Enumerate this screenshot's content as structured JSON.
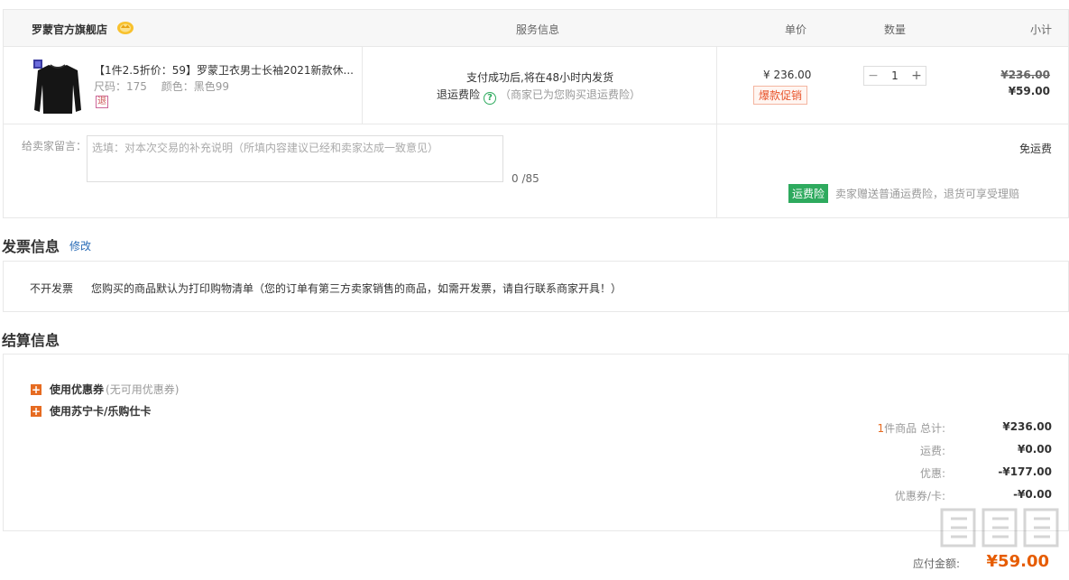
{
  "store": {
    "name": "罗蒙官方旗舰店",
    "badge_icon": "gold-crown-icon"
  },
  "columns": {
    "service": "服务信息",
    "unit_price": "单价",
    "quantity": "数量",
    "subtotal": "小计"
  },
  "item": {
    "title": "【1件2.5折价：59】罗蒙卫衣男士长袖2021新款休...",
    "size": "尺码：175",
    "color": "颜色：黑色99",
    "return_tag": "退",
    "service_line1": "支付成功后,将在48小时内发货",
    "service_ins_label": "退运费险",
    "service_ins_note": "（商家已为您购买退运费险）",
    "unit_price": "¥ 236.00",
    "promo": "爆款促销",
    "quantity": "1",
    "original_total": "¥236.00",
    "sale_total": "¥59.00"
  },
  "message": {
    "label": "给卖家留言：",
    "placeholder": "选填：对本次交易的补充说明（所填内容建议已经和卖家达成一致意见）",
    "count": "0 /85"
  },
  "shipping": {
    "free": "免运费",
    "insurance_badge": "运费险",
    "insurance_note": "卖家赠送普通运费险，退货可享受理赔"
  },
  "invoice": {
    "title": "发票信息",
    "edit": "修改",
    "type": "不开发票",
    "desc": "您购买的商品默认为打印购物清单（您的订单有第三方卖家销售的商品，如需开发票，请自行联系商家开具！）"
  },
  "settlement": {
    "title": "结算信息",
    "coupon_label": "使用优惠券",
    "coupon_sub": "(无可用优惠券)",
    "card_label": "使用苏宁卡/乐购仕卡",
    "count_num": "1",
    "count_label": "件商品 总计:",
    "total": "¥236.00",
    "shipping_label": "运费:",
    "shipping": "¥0.00",
    "discount_label": "优惠:",
    "discount": "-¥177.00",
    "voucher_label": "优惠券/卡:",
    "voucher": "-¥0.00",
    "payable_label": "应付金额:",
    "payable": "¥59.00"
  },
  "colors": {
    "accent": "#e66b21",
    "green": "#2eaa5e",
    "link": "#2a6cb7"
  }
}
